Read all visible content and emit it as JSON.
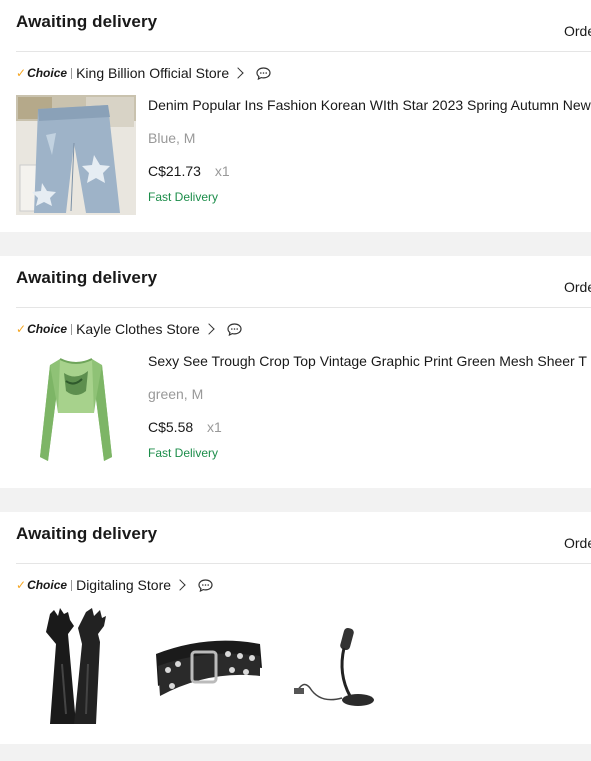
{
  "orders": [
    {
      "status": "Awaiting delivery",
      "order_link": "Orde",
      "choice_label": "Choice",
      "store": "King Billion Official Store",
      "items": [
        {
          "title": "Denim Popular Ins Fashion Korean WIth Star 2023 Spring Autumn New",
          "sku": "Blue, M",
          "price": "C$21.73",
          "qty": "x1",
          "delivery": "Fast Delivery"
        }
      ]
    },
    {
      "status": "Awaiting delivery",
      "order_link": "Orde",
      "choice_label": "Choice",
      "store": "Kayle Clothes Store",
      "items": [
        {
          "title": "Sexy See Trough Crop Top Vintage Graphic Print Green Mesh Sheer T",
          "sku": "green, M",
          "price": "C$5.58",
          "qty": "x1",
          "delivery": "Fast Delivery"
        }
      ]
    },
    {
      "status": "Awaiting delivery",
      "order_link": "Orde",
      "choice_label": "Choice",
      "store": "Digitaling Store",
      "items": [
        {
          "image": "black-long-gloves"
        },
        {
          "image": "black-star-studded-belt"
        },
        {
          "image": "usb-desk-microphone"
        }
      ]
    }
  ],
  "colors": {
    "choice_check": "#f5a623",
    "fast_delivery": "#1c8d4a",
    "muted_text": "#999999",
    "divider": "#e5e5e5",
    "page_bg": "#f2f2f2"
  }
}
